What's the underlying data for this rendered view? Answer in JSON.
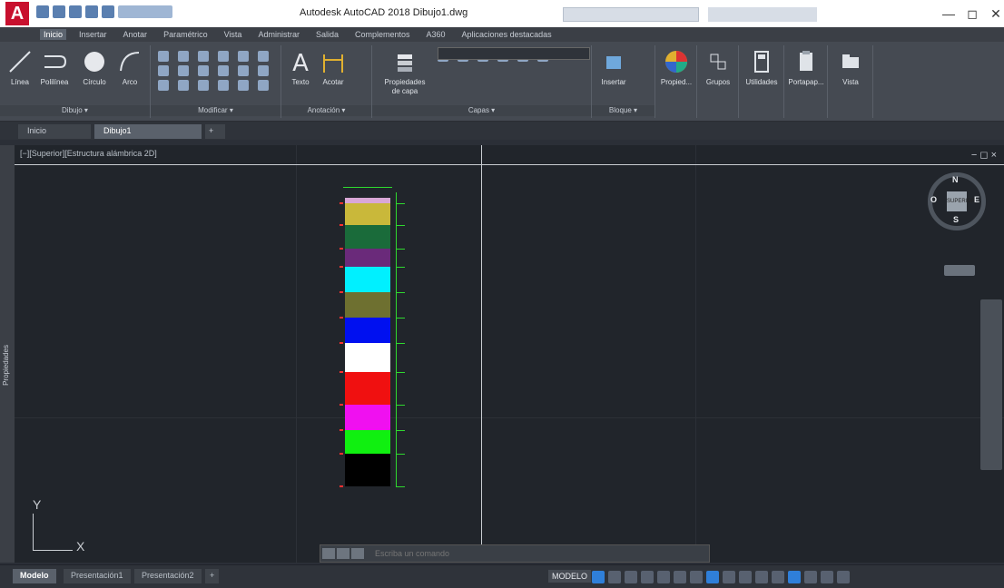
{
  "window": {
    "title": "Autodesk AutoCAD 2018   Dibujo1.dwg",
    "logo": "A"
  },
  "ribbon": {
    "tabs": [
      "Inicio",
      "Insertar",
      "Anotar",
      "Paramétrico",
      "Vista",
      "Administrar",
      "Salida",
      "Complementos",
      "A360",
      "Aplicaciones destacadas"
    ],
    "tools": {
      "linea": "Línea",
      "polilinea": "Polilínea",
      "circulo": "Círculo",
      "arco": "Arco",
      "texto": "Texto",
      "acotar": "Acotar",
      "propiedades_capa": "Propiedades de capa",
      "insertar": "Insertar",
      "propiedades": "Propied...",
      "grupos": "Grupos",
      "utilidades": "Utilidades",
      "portapapeles": "Portapap...",
      "vista": "Vista"
    },
    "panels": {
      "dibujo": "Dibujo ▾",
      "modificar": "Modificar ▾",
      "anotacion": "Anotación ▾",
      "capas": "Capas ▾",
      "bloque": "Bloque ▾"
    }
  },
  "file_tabs": {
    "inicio": "Inicio",
    "dibujo1": "Dibujo1"
  },
  "viewport": {
    "label": "[−][Superior][Estructura alámbrica 2D]",
    "controls": "− ◻ ×"
  },
  "sidebar": {
    "label": "Propiedades"
  },
  "viewcube": {
    "n": "N",
    "s": "S",
    "e": "E",
    "o": "O",
    "face": "SUPERIOR"
  },
  "ucs": {
    "x": "X",
    "y": "Y"
  },
  "command": {
    "placeholder": "Escriba un comando"
  },
  "layout_tabs": [
    "Modelo",
    "Presentación1",
    "Presentación2"
  ],
  "status": {
    "model": "MODELO"
  },
  "swatches": [
    {
      "color": "#d9a7d6"
    },
    {
      "color": "#c9b83a"
    },
    {
      "color": "#1a6b3a"
    },
    {
      "color": "#6a2a7a"
    },
    {
      "color": "#00f0ff"
    },
    {
      "color": "#6e7030"
    },
    {
      "color": "#0010f0"
    },
    {
      "color": "#ffffff"
    },
    {
      "color": "#f01010"
    },
    {
      "color": "#f010f0"
    },
    {
      "color": "#10f010"
    },
    {
      "color": "#000000"
    }
  ]
}
